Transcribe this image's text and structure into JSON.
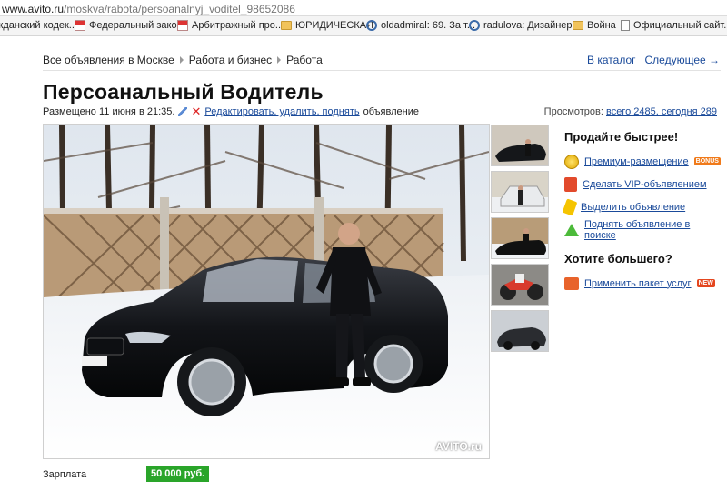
{
  "browser": {
    "url_host": "www.avito.ru",
    "url_path": "/moskva/rabota/persoanalnyj_voditel_98652086",
    "bookmarks": [
      {
        "label": "жданский кодек...",
        "icon": "page-icon"
      },
      {
        "label": "Федеральный зако...",
        "icon": "flag-icon"
      },
      {
        "label": "Арбитражный про...",
        "icon": "flag-icon"
      },
      {
        "label": "ЮРИДИЧЕСКАЯ",
        "icon": "folder-icon"
      },
      {
        "label": "oldadmiral: 69. За т...",
        "icon": "paperclip-icon"
      },
      {
        "label": "radulova: Дизайнер...",
        "icon": "paperclip-icon"
      },
      {
        "label": "Война",
        "icon": "folder-icon"
      },
      {
        "label": "Официальный сайт...",
        "icon": "page-icon"
      }
    ]
  },
  "breadcrumbs": [
    "Все объявления в Москве",
    "Работа и бизнес",
    "Работа"
  ],
  "nav": {
    "catalog": "В каталог",
    "next": "Следующее →"
  },
  "listing": {
    "title": "Персоанальный Водитель",
    "posted": "Размещено 11 июня в 21:35.",
    "edit_link": "Редактировать, удалить, поднять",
    "edit_suffix": "объявление",
    "views_label": "Просмотров:",
    "views_value": "всего 2485, сегодня 289",
    "watermark": "AVITO.ru",
    "salary_label": "Зарплата",
    "salary_value": "50 000 руб."
  },
  "sidebar": {
    "sell_title": "Продайте быстрее!",
    "sell_items": [
      {
        "label": "Премиум-размещение",
        "icon": "coin-icon",
        "tag": "BONUS"
      },
      {
        "label": "Сделать VIP-объявлением",
        "icon": "vip-icon",
        "tag": ""
      },
      {
        "label": "Выделить объявление",
        "icon": "marker-icon",
        "tag": ""
      },
      {
        "label": "Поднять объявление в поиске",
        "icon": "arrow-up-icon",
        "tag": ""
      }
    ],
    "more_title": "Хотите большего?",
    "more_items": [
      {
        "label": "Применить пакет услуг",
        "icon": "package-icon",
        "tag": "NEW"
      }
    ]
  },
  "colors": {
    "link": "#1a4a9a",
    "salary_bg": "#2aa52a",
    "title": "#111111"
  }
}
